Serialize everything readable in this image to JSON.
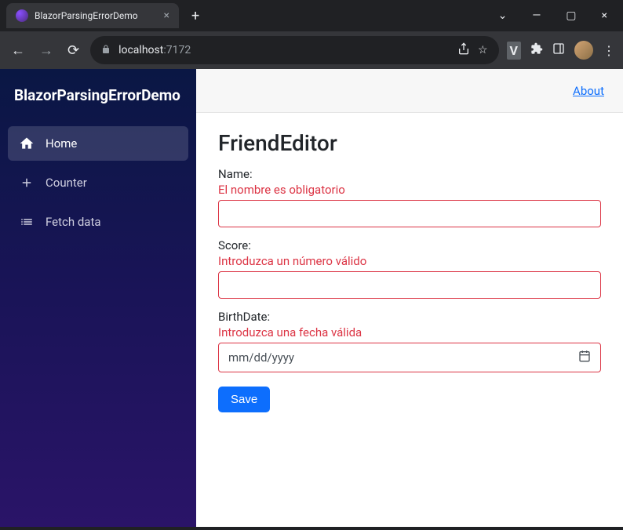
{
  "browser": {
    "tab_title": "BlazorParsingErrorDemo",
    "url_host": "localhost",
    "url_port": ":7172",
    "ext_badge": "V"
  },
  "sidebar": {
    "brand": "BlazorParsingErrorDemo",
    "items": [
      {
        "label": "Home",
        "active": true
      },
      {
        "label": "Counter",
        "active": false
      },
      {
        "label": "Fetch data",
        "active": false
      }
    ]
  },
  "topbar": {
    "about": "About"
  },
  "page": {
    "title": "FriendEditor",
    "fields": {
      "name": {
        "label": "Name:",
        "error": "El nombre es obligatorio",
        "value": ""
      },
      "score": {
        "label": "Score:",
        "error": "Introduzca un número válido",
        "value": ""
      },
      "birthdate": {
        "label": "BirthDate:",
        "error": "Introduzca una fecha válida",
        "placeholder": "mm/dd/yyyy"
      }
    },
    "save_label": "Save"
  }
}
